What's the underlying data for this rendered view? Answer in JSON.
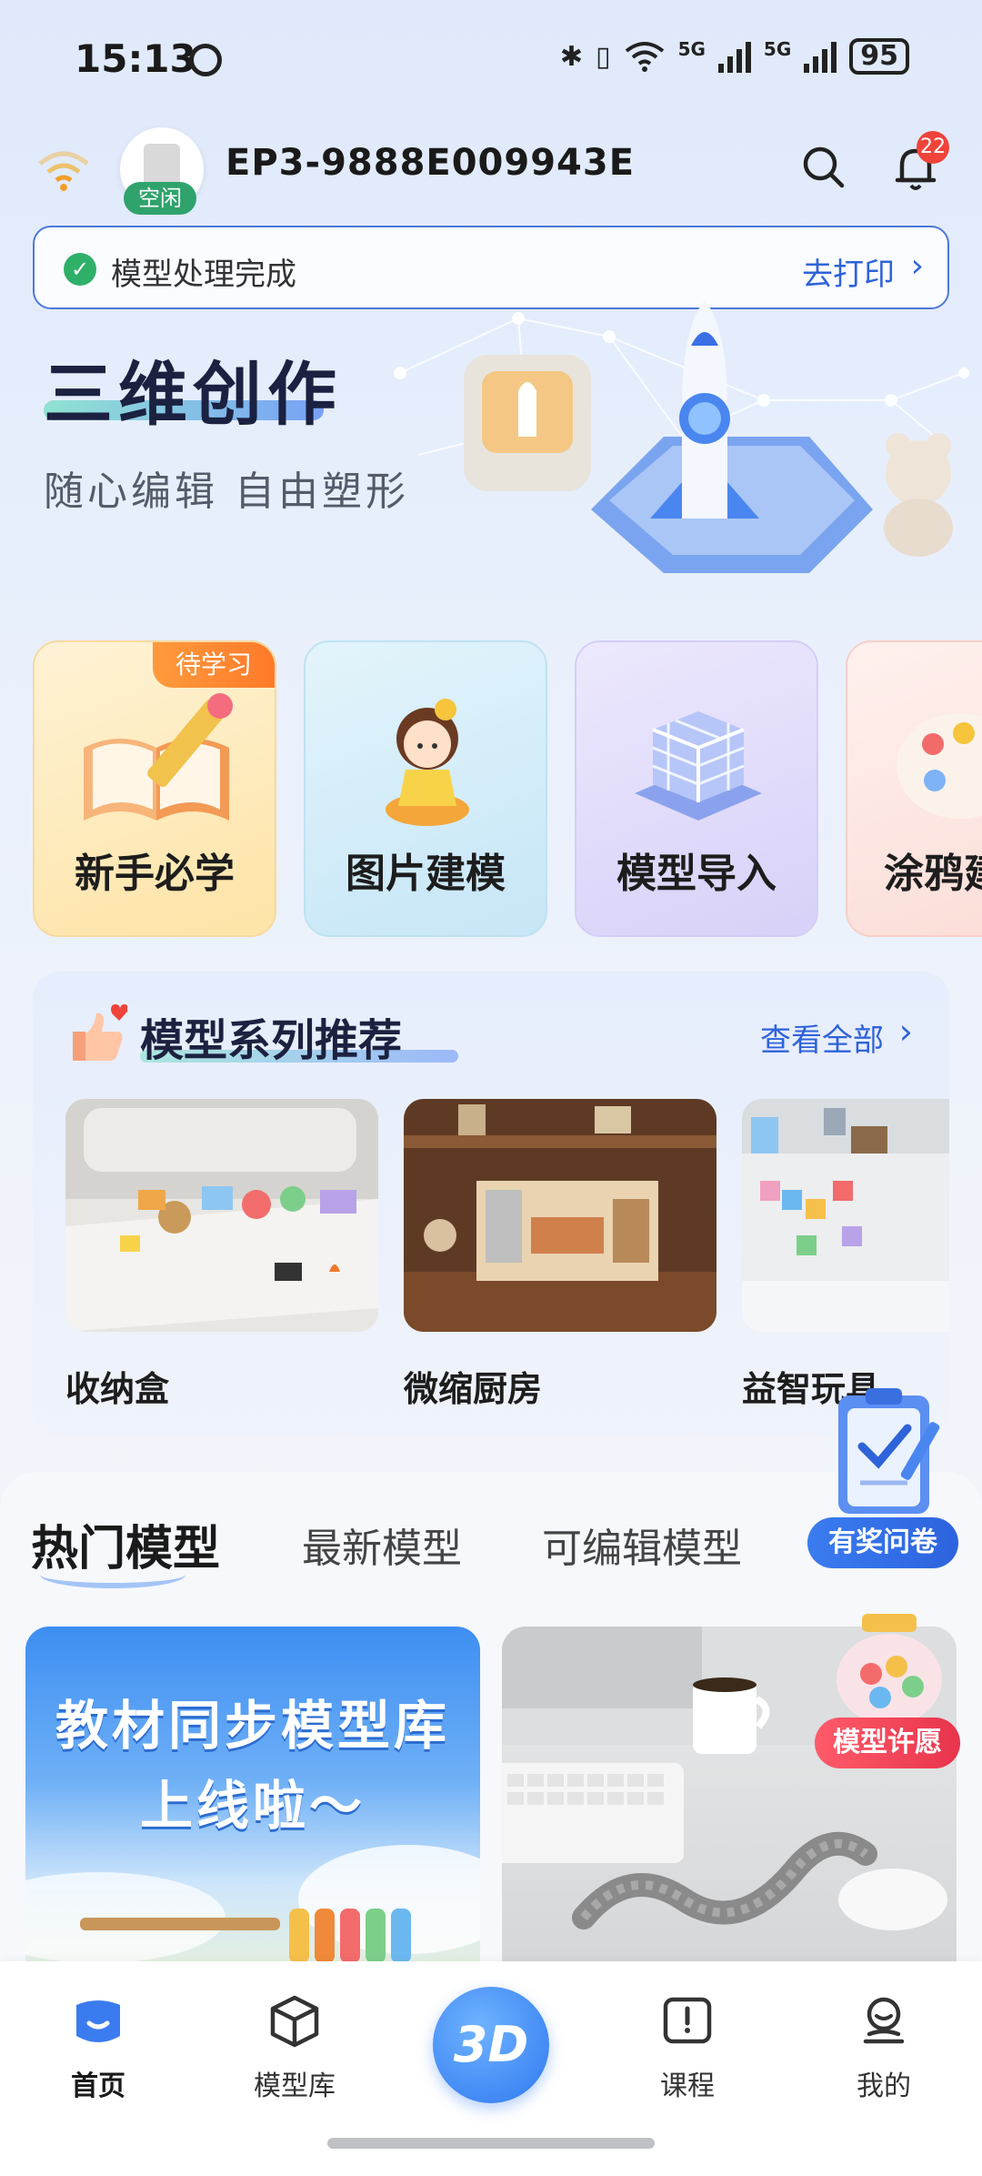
{
  "status_bar": {
    "time": "15:13",
    "network_5g_a": "5G",
    "network_5g_b": "5G",
    "battery": "95"
  },
  "header": {
    "device_name": "EP3-9888E009943E",
    "device_status": "空闲",
    "notification_count": "22"
  },
  "notice": {
    "message": "模型处理完成",
    "action": "去打印"
  },
  "hero": {
    "title": "三维创作",
    "subtitle": "随心编辑 自由塑形"
  },
  "tiles": [
    {
      "label": "新手必学",
      "tag": "待学习"
    },
    {
      "label": "图片建模"
    },
    {
      "label": "模型导入"
    },
    {
      "label": "涂鸦建"
    }
  ],
  "series": {
    "title": "模型系列推荐",
    "more": "查看全部",
    "items": [
      {
        "name": "收纳盒"
      },
      {
        "name": "微缩厨房"
      },
      {
        "name": "益智玩具"
      }
    ]
  },
  "hot": {
    "tabs": [
      "热门模型",
      "最新模型",
      "可编辑模型"
    ],
    "survey_label": "有奖问卷",
    "wish_label": "模型许愿",
    "banner_line1": "教材同步模型库",
    "banner_line2": "上线啦～"
  },
  "bottom_nav": {
    "items": [
      "首页",
      "模型库",
      "课程",
      "我的"
    ],
    "center": "3D"
  },
  "colors": {
    "accent": "#2f63d9",
    "success": "#2fb069",
    "badge": "#f0443b"
  }
}
